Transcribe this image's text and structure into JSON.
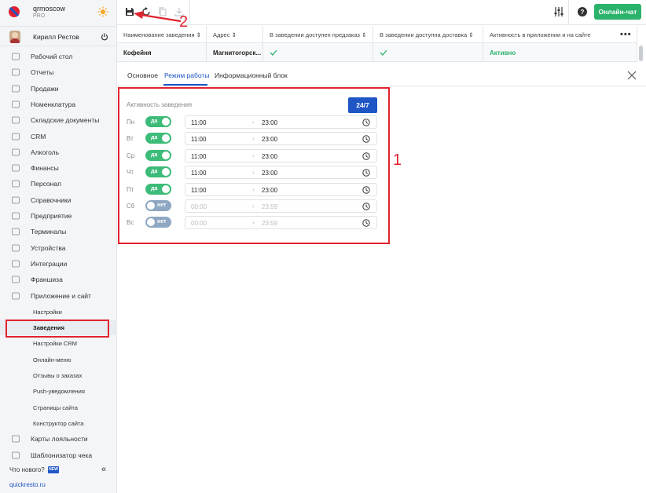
{
  "brand": {
    "name": "qrmoscow",
    "plan": "PRO"
  },
  "user": {
    "name": "Кирилл Рестов"
  },
  "sidebar": {
    "items": [
      {
        "label": "Рабочий стол",
        "icon": "dashboard-icon"
      },
      {
        "label": "Отчеты",
        "icon": "reports-icon"
      },
      {
        "label": "Продажи",
        "icon": "sales-icon"
      },
      {
        "label": "Номенклатура",
        "icon": "nomenclature-icon"
      },
      {
        "label": "Складские документы",
        "icon": "warehouse-icon"
      },
      {
        "label": "CRM",
        "icon": "crm-icon"
      },
      {
        "label": "Алкоголь",
        "icon": "alcohol-icon"
      },
      {
        "label": "Финансы",
        "icon": "finance-icon"
      },
      {
        "label": "Персонал",
        "icon": "staff-icon"
      },
      {
        "label": "Справочники",
        "icon": "directory-icon"
      },
      {
        "label": "Предприятие",
        "icon": "enterprise-icon"
      },
      {
        "label": "Терминалы",
        "icon": "terminal-icon"
      },
      {
        "label": "Устройства",
        "icon": "devices-icon"
      },
      {
        "label": "Интеграции",
        "icon": "integrations-icon"
      },
      {
        "label": "Франшиза",
        "icon": "franchise-icon"
      },
      {
        "label": "Приложение и сайт",
        "icon": "app-site-icon"
      }
    ],
    "subitems": [
      "Настройки",
      "Заведения",
      "Настройки CRM",
      "Онлайн-меню",
      "Отзывы о заказах",
      "Push-уведомления",
      "Страницы сайта",
      "Конструктор сайта"
    ],
    "active_subitem": "Заведения",
    "bottom_items": [
      {
        "label": "Карты лояльности",
        "icon": "loyalty-icon"
      },
      {
        "label": "Шаблонизатор чека",
        "icon": "receipt-icon"
      }
    ],
    "whats_new": "Что нового?",
    "new_badge": "NEW",
    "collapse": "«",
    "site_link": "quickresto.ru"
  },
  "toolbar": {
    "chat_label": "Онлайн-чат"
  },
  "table": {
    "headers": [
      "Наименование заведения",
      "Адрес",
      "В заведении доступен предзаказ",
      "В заведении доступна доставка",
      "Активность в приложении и на сайте"
    ],
    "row": {
      "name": "Кофейня",
      "address": "Магнитогорск...",
      "preorder": true,
      "delivery": true,
      "activity": "Активно"
    }
  },
  "tabs": [
    "Основное",
    "Режим работы",
    "Информационный блок"
  ],
  "active_tab": "Режим работы",
  "schedule": {
    "label": "Активность заведения",
    "btn_247": "24/7",
    "days": [
      {
        "day": "Пн",
        "on": true,
        "toggle": "да",
        "from": "11:00",
        "to": "23:00"
      },
      {
        "day": "Вт",
        "on": true,
        "toggle": "да",
        "from": "11:00",
        "to": "23:00"
      },
      {
        "day": "Ср",
        "on": true,
        "toggle": "да",
        "from": "11:00",
        "to": "23:00"
      },
      {
        "day": "Чт",
        "on": true,
        "toggle": "да",
        "from": "11:00",
        "to": "23:00"
      },
      {
        "day": "Пт",
        "on": true,
        "toggle": "да",
        "from": "11:00",
        "to": "23:00"
      },
      {
        "day": "Сб",
        "on": false,
        "toggle": "нет",
        "from": "00:00",
        "to": "23:59"
      },
      {
        "day": "Вс",
        "on": false,
        "toggle": "нет",
        "from": "00:00",
        "to": "23:59"
      }
    ]
  },
  "annotations": {
    "one": "1",
    "two": "2"
  },
  "colors": {
    "accent": "#1f56c6",
    "success": "#2bb26b",
    "highlight": "#e0232f"
  }
}
